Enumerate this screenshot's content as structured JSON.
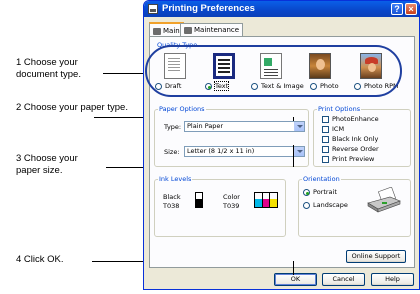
{
  "callouts": [
    "1 Choose your document type.",
    "2 Choose your paper type.",
    "3 Choose your paper size.",
    "4 Click OK."
  ],
  "window": {
    "title": "Printing Preferences",
    "help_glyph": "?",
    "close_glyph": "×"
  },
  "tabs": [
    "Main",
    "Maintenance"
  ],
  "quality": {
    "label": "Quality Type",
    "options": [
      "Draft",
      "Text",
      "Text & Image",
      "Photo",
      "Photo RPM"
    ],
    "selected": "Text"
  },
  "paper": {
    "label": "Paper Options",
    "type_label": "Type:",
    "type_value": "Plain Paper",
    "size_label": "Size:",
    "size_value": "Letter (8 1/2 x 11 in)"
  },
  "print_options": {
    "label": "Print Options",
    "items": [
      "PhotoEnhance",
      "ICM",
      "Black Ink Only",
      "Reverse Order",
      "Print Preview"
    ]
  },
  "ink": {
    "label": "Ink Levels",
    "black_name": "Black",
    "black_code": "T038",
    "color_name": "Color",
    "color_code": "T039",
    "black_level": 0.6,
    "color_levels": {
      "cyan": 0.55,
      "magenta": 0.55,
      "yellow": 0.55
    },
    "ink_colors": {
      "cyan": "#00b8e8",
      "magenta": "#e0008c",
      "yellow": "#f4e000"
    }
  },
  "orientation": {
    "label": "Orientation",
    "options": [
      "Portrait",
      "Landscape"
    ],
    "selected": "Portrait"
  },
  "buttons": {
    "online_support": "Online Support",
    "ok": "OK",
    "cancel": "Cancel",
    "help": "Help"
  }
}
